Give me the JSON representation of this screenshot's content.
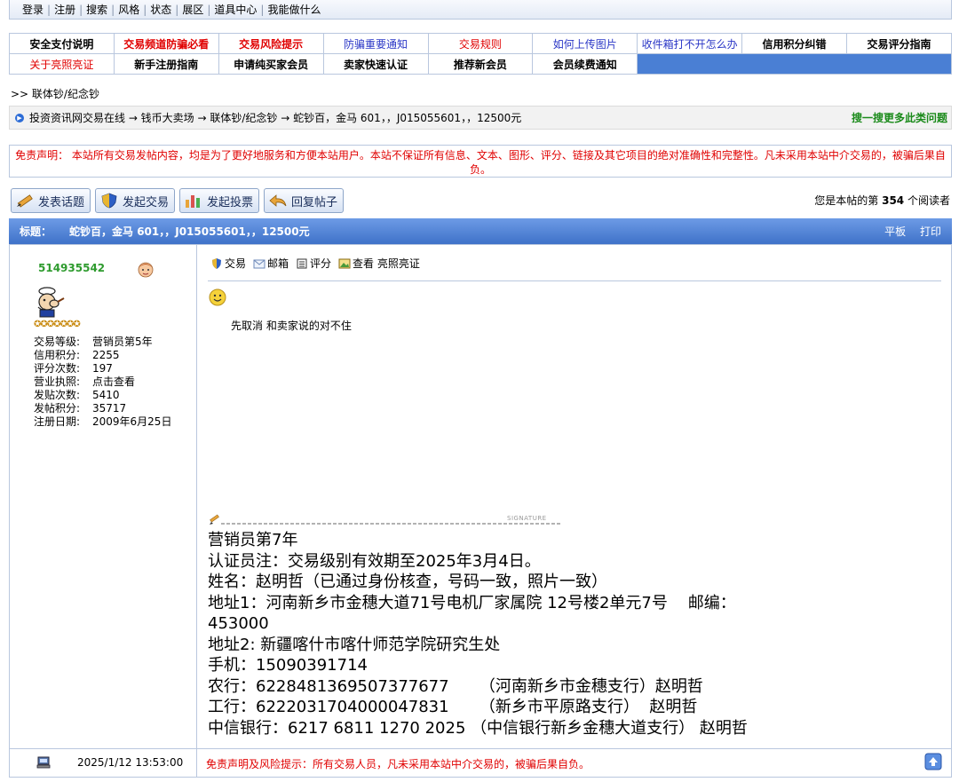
{
  "topnav": [
    "登录",
    "注册",
    "搜索",
    "风格",
    "状态",
    "展区",
    "道具中心",
    "我能做什么"
  ],
  "quicklinks": {
    "row1": [
      "安全支付说明",
      "交易频道防骗必看",
      "交易风险提示",
      "防骗重要通知",
      "交易规则",
      "如何上传图片",
      "收件箱打不开怎么办",
      "信用积分纠错",
      "交易评分指南"
    ],
    "row2": [
      "关于亮照亮证",
      "新手注册指南",
      "申请纯买家会员",
      "卖家快速认证",
      "推荐新会员",
      "会员续费通知"
    ]
  },
  "breadcrumb": ">> 联体钞/纪念钞",
  "path": {
    "text": "投资资讯网交易在线 → 钱币大卖场 → 联体钞/纪念钞 → 蛇钞百，金马 601，，J015055601，，12500元",
    "search_more": "搜一搜更多此类问题"
  },
  "disclaimer": "免责声明： 本站所有交易发帖内容，均是为了更好地服务和方便本站用户。本站不保证所有信息、文本、图形、评分、链接及其它项目的绝对准确性和完整性。凡未采用本站中介交易的，被骗后果自负。",
  "buttons": {
    "post_topic": "发表话题",
    "start_trade": "发起交易",
    "start_poll": "发起投票",
    "reply": "回复帖子"
  },
  "readers": {
    "prefix": "您是本帖的第",
    "count": "354",
    "suffix": "个阅读者"
  },
  "titlebar": {
    "label": "标题：",
    "title": "蛇钞百，金马 601，，J015055601，，12500元",
    "flat": "平板",
    "print": "打印"
  },
  "user": {
    "name": "514935542",
    "stats": [
      {
        "k": "交易等级:",
        "v": "营销员第5年"
      },
      {
        "k": "信用积分:",
        "v": "2255"
      },
      {
        "k": "评分次数:",
        "v": "197"
      },
      {
        "k": "营业执照:",
        "v": "点击查看"
      },
      {
        "k": "发贴次数:",
        "v": "5410"
      },
      {
        "k": "发帖积分:",
        "v": "35717"
      },
      {
        "k": "注册日期:",
        "v": "2009年6月25日"
      }
    ]
  },
  "post_actions": {
    "trade": "交易",
    "mailbox": "邮箱",
    "rate": "评分",
    "view": "查看 亮照亮证"
  },
  "post_body": "先取消  和卖家说的对不住",
  "signature": {
    "tag": "SIGNATURE",
    "lines": [
      "营销员第7年",
      "认证员注：交易级别有效期至2025年3月4日。",
      "姓名：赵明哲（已通过身份核查，号码一致，照片一致）",
      "地址1：河南新乡市金穗大道71号电机厂家属院 12号楼2单元7号    邮编：",
      "453000",
      "地址2: 新疆喀什市喀什师范学院研究生处",
      "手机：15090391714",
      "农行：6228481369507377677      （河南新乡市金穗支行）赵明哲",
      "工行：6222031704000047831      （新乡市平原路支行）  赵明哲",
      "中信银行：6217 6811 1270 2025 （中信银行新乡金穗大道支行） 赵明哲"
    ]
  },
  "footer": {
    "time": "2025/1/12 13:53:00",
    "warning": "免责声明及风险提示：所有交易人员，凡未采用本站中介交易的，被骗后果自负。"
  }
}
